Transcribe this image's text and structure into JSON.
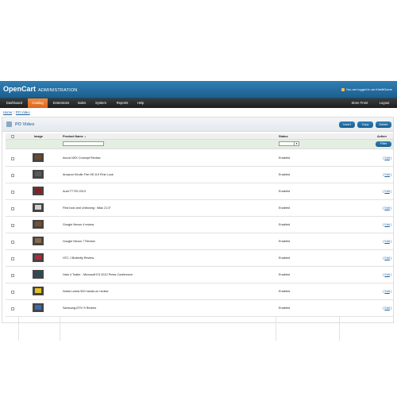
{
  "header": {
    "logo": "OpenCart",
    "subtitle": "ADMINISTRATION",
    "logged_in": "You are logged in as KheiltGome"
  },
  "menu": {
    "items": [
      {
        "label": "Dashboard"
      },
      {
        "label": "Catalog"
      },
      {
        "label": "Extensions"
      },
      {
        "label": "Sales"
      },
      {
        "label": "System"
      },
      {
        "label": "Reports"
      },
      {
        "label": "Help"
      }
    ],
    "store_front": "Store Front",
    "logout": "Logout"
  },
  "breadcrumb": {
    "home": "Home",
    "separator": " :: ",
    "current": "PO Video"
  },
  "box": {
    "title": "PO Video",
    "buttons": {
      "insert": "Insert",
      "copy": "Copy",
      "delete": "Delete",
      "filter": "Filter"
    }
  },
  "table": {
    "columns": {
      "image": "Image",
      "product_name": "Product Name",
      "sort_arrow": "▲",
      "status": "Status",
      "action": "Action"
    },
    "rows": [
      {
        "name": "Acura NSX Concept Review",
        "status": "Enabled",
        "action": "Edit",
        "thumb_color": "#6b4a2a"
      },
      {
        "name": "Amazon Kindle Fire HD 8.9 First Look",
        "status": "Enabled",
        "action": "Edit",
        "thumb_color": "#5a5a5a"
      },
      {
        "name": "Audi TT RS 2013",
        "status": "Enabled",
        "action": "Edit",
        "thumb_color": "#8a1f1f"
      },
      {
        "name": "First look and Unboxing : iMac 21.5\"",
        "status": "Enabled",
        "action": "Edit",
        "thumb_color": "#d0d0d0"
      },
      {
        "name": "Google Nexus 4 review",
        "status": "Enabled",
        "action": "Edit",
        "thumb_color": "#7a5030"
      },
      {
        "name": "Google Nexus 7 Review",
        "status": "Enabled",
        "action": "Edit",
        "thumb_color": "#8a6a4a"
      },
      {
        "name": "HTC J Butterfly Review",
        "status": "Enabled",
        "action": "Edit",
        "thumb_color": "#b02a3a"
      },
      {
        "name": "Halo 4 Trailer - Microsoft E3 2012 Press Conference",
        "status": "Enabled",
        "action": "Edit",
        "thumb_color": "#2c4a5a"
      },
      {
        "name": "Nokia Lumia 920 hands-on review",
        "status": "Enabled",
        "action": "Edit",
        "thumb_color": "#e8c21a"
      },
      {
        "name": "Samsung ATIV S Review",
        "status": "Enabled",
        "action": "Edit",
        "thumb_color": "#3a6ab0"
      }
    ]
  },
  "colors": {
    "header": "#1f6596",
    "menu": "#2a2a2a",
    "active_tab": "#e4762a",
    "link": "#1a5fa0",
    "filter_row": "#e3efe1"
  }
}
